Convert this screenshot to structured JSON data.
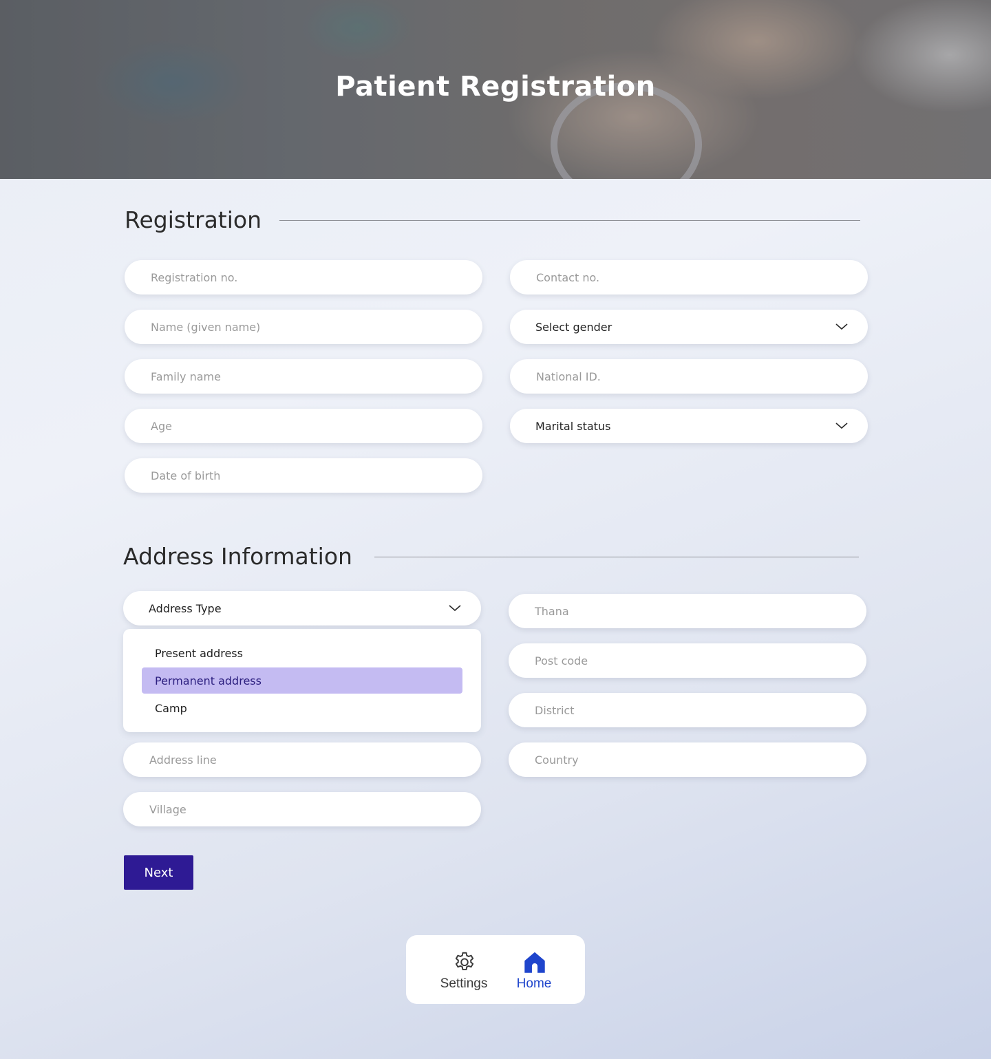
{
  "header": {
    "title": "Patient Registration"
  },
  "registration": {
    "title": "Registration",
    "fields": {
      "registration_no": "Registration no.",
      "contact_no": "Contact no.",
      "name": "Name  (given name)",
      "gender": "Select gender",
      "family_name": "Family name",
      "national_id": "National ID.",
      "age": "Age",
      "marital_status": "Marital status",
      "dob": "Date of birth"
    }
  },
  "address": {
    "title": "Address Information",
    "address_type": "Address Type",
    "options": [
      "Present address",
      "Permanent address",
      "Camp"
    ],
    "selected_option": "Permanent address",
    "fields": {
      "thana": "Thana",
      "post_code": "Post code",
      "district": "District",
      "country": "Country",
      "address_line": "Address line",
      "village": "Village"
    }
  },
  "actions": {
    "next": "Next"
  },
  "bottom_nav": {
    "settings": "Settings",
    "home": "Home",
    "active": "home",
    "active_color": "#1f45cc",
    "inactive_color": "#3a3a3a"
  },
  "colors": {
    "primary_button": "#2e1a94",
    "selected_option_bg": "#c4bbf2"
  }
}
